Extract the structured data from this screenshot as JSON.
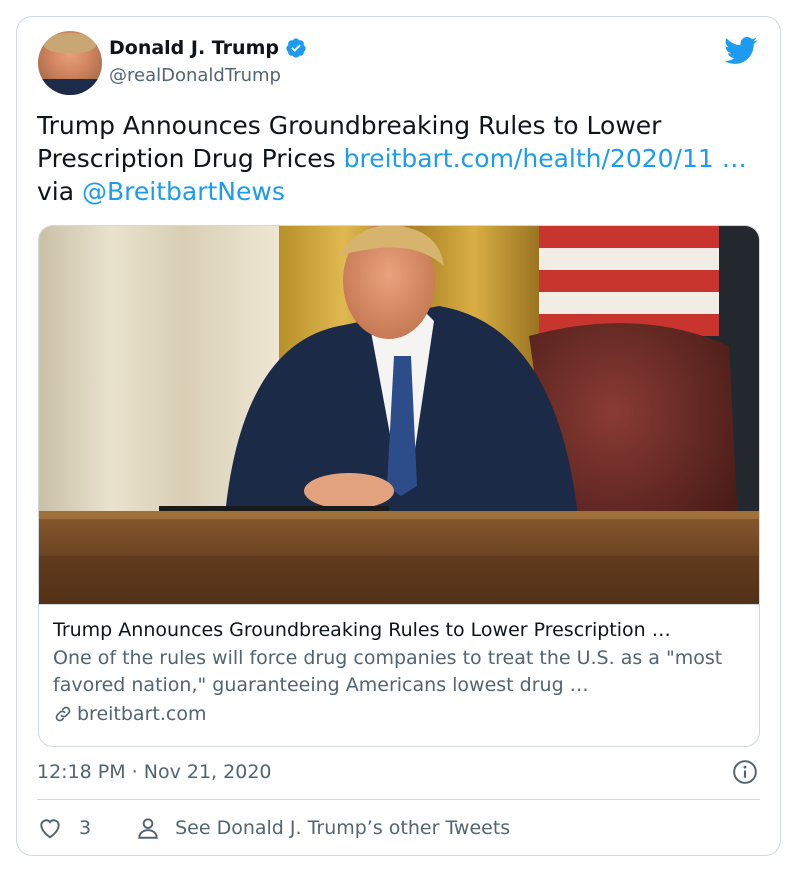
{
  "author": {
    "display_name": "Donald J. Trump",
    "handle": "@realDonaldTrump",
    "verified": true
  },
  "tweet": {
    "text_part1": "Trump Announces Groundbreaking Rules to Lower Prescription Drug Prices ",
    "link_url": "breitbart.com/health/2020/11 …",
    "text_via": " via ",
    "mention": "@BreitbartNews"
  },
  "link_card": {
    "title": "Trump Announces Groundbreaking Rules to Lower Prescription …",
    "description": "One of the rules will force drug companies to treat the U.S. as a \"most favored nation,\" guaranteeing Americans lowest drug …",
    "domain": "breitbart.com"
  },
  "timestamp": "12:18 PM · Nov 21, 2020",
  "actions": {
    "like_count": "3",
    "profile_link_label": "See Donald J. Trump’s other Tweets"
  },
  "colors": {
    "accent": "#1d9bf0",
    "secondary_text": "#536471",
    "border": "#cfd9de"
  },
  "icons": [
    "verified-icon",
    "twitter-bird-icon",
    "link-icon",
    "info-icon",
    "heart-icon",
    "person-icon"
  ]
}
